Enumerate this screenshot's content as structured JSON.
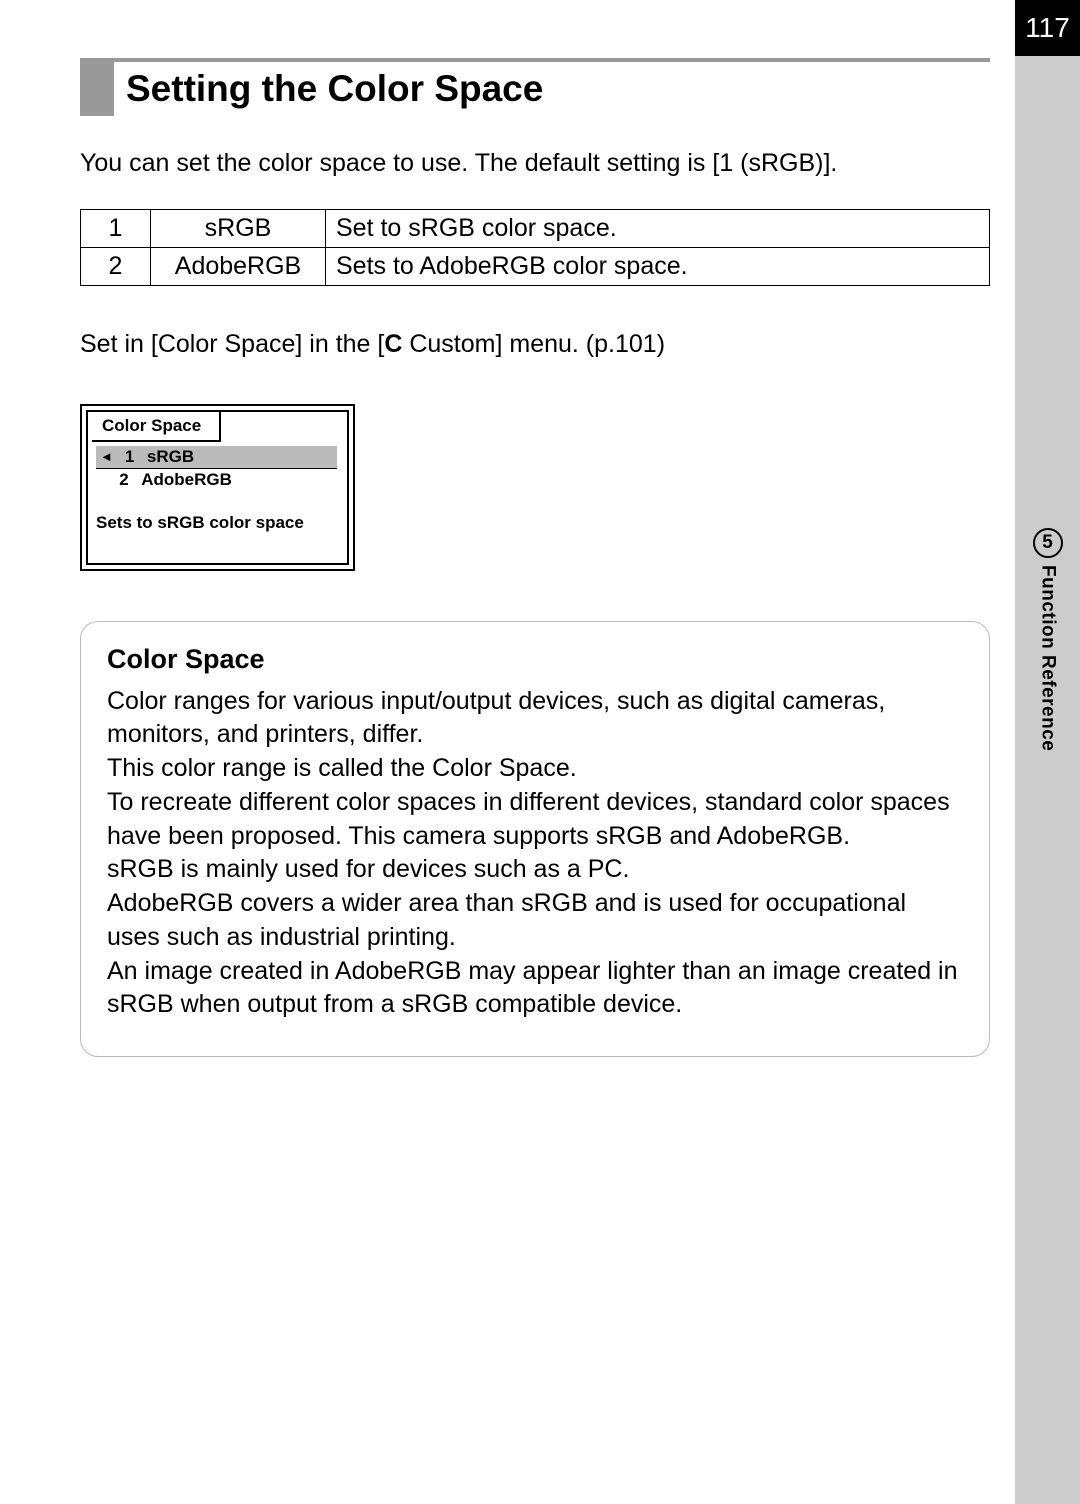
{
  "page_number": "117",
  "chapter_number": "5",
  "chapter_label": "Function Reference",
  "title": "Setting the Color Space",
  "intro": "You can set the color space to use. The default setting is [1 (sRGB)].",
  "table": {
    "rows": [
      {
        "num": "1",
        "name": "sRGB",
        "desc": "Set to sRGB color space."
      },
      {
        "num": "2",
        "name": "AdobeRGB",
        "desc": "Sets to AdobeRGB color space."
      }
    ]
  },
  "menu_note_pre": "Set in [Color Space] in the [",
  "menu_note_bold": "C",
  "menu_note_post": " Custom] menu. (p.101)",
  "lcd": {
    "tab": "Color Space",
    "option1_num": "1",
    "option1_label": "sRGB",
    "option2_num": "2",
    "option2_label": "AdobeRGB",
    "help": "Sets to sRGB color space"
  },
  "info": {
    "title": "Color Space",
    "body": "Color ranges for various input/output devices, such as digital cameras, monitors, and printers, differ.\nThis color range is called the Color Space.\nTo recreate different color spaces in different devices, standard color spaces have been proposed. This camera supports sRGB and AdobeRGB.\nsRGB is mainly used for devices such as a PC.\nAdobeRGB covers a wider area than sRGB and is used for occupational uses such as industrial printing.\nAn image created in AdobeRGB may appear lighter than an image created in sRGB when output from a sRGB compatible device."
  }
}
